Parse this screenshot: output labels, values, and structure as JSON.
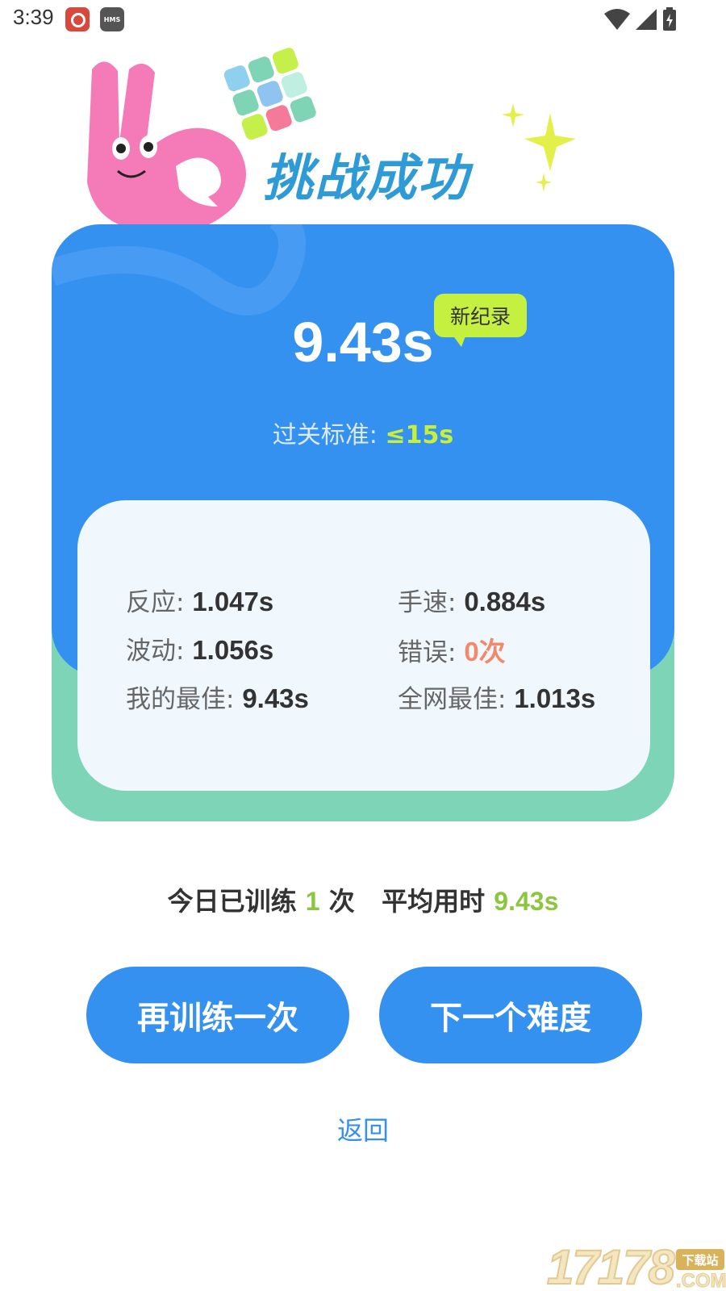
{
  "status_bar": {
    "time": "3:39",
    "hms_label": "HMS"
  },
  "header": {
    "title": "挑战成功"
  },
  "result": {
    "time": "9.43s",
    "record_badge": "新纪录",
    "pass_label": "过关标准: ",
    "pass_value": "≤15s"
  },
  "stats": {
    "reaction": {
      "label": "反应: ",
      "value": "1.047s"
    },
    "speed": {
      "label": "手速: ",
      "value": "0.884s"
    },
    "fluctuation": {
      "label": "波动: ",
      "value": "1.056s"
    },
    "errors": {
      "label": "错误: ",
      "value": "0次"
    },
    "my_best": {
      "label": "我的最佳: ",
      "value": "9.43s"
    },
    "global_best": {
      "label": "全网最佳: ",
      "value": "1.013s"
    }
  },
  "today": {
    "prefix": "今日已训练 ",
    "count": "1",
    "middle": " 次   平均用时 ",
    "avg": "9.43s"
  },
  "buttons": {
    "retry": "再训练一次",
    "next": "下一个难度"
  },
  "back": "返回",
  "watermark": {
    "main": "17178",
    "tag": "下载站",
    "com": ".COM"
  },
  "colors": {
    "primary": "#3591f0",
    "green": "#7ed4b6",
    "accent_lime": "#c5f040",
    "error": "#f08a6a"
  }
}
